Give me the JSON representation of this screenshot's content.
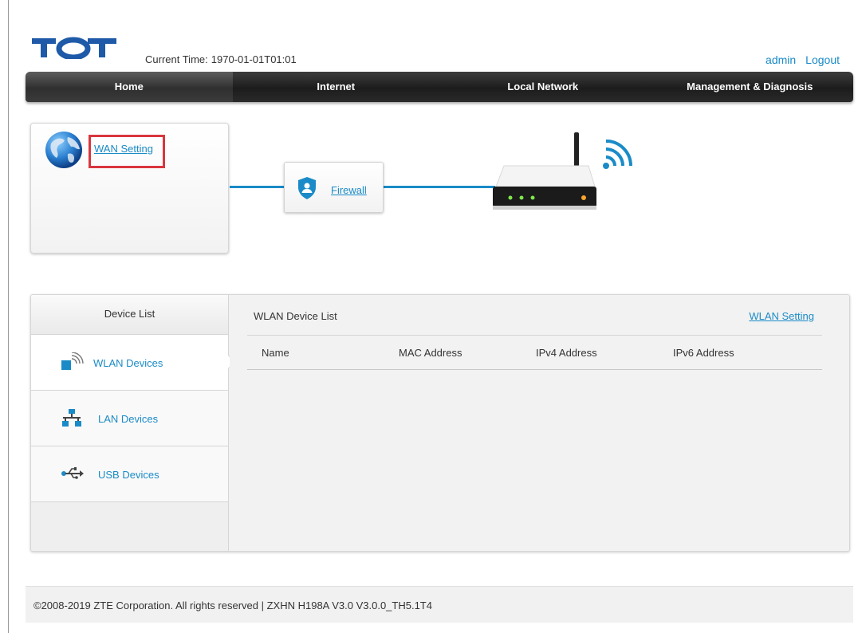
{
  "header": {
    "logo_text": "TOT",
    "current_time_label": "Current Time:",
    "current_time_value": "1970-01-01T01:01",
    "user": "admin",
    "logout": "Logout"
  },
  "nav": {
    "items": [
      {
        "label": "Home",
        "active": true
      },
      {
        "label": "Internet",
        "active": false
      },
      {
        "label": "Local Network",
        "active": false
      },
      {
        "label": "Management & Diagnosis",
        "active": false
      }
    ]
  },
  "topology": {
    "wan_link": "WAN Setting",
    "firewall_link": "Firewall"
  },
  "device_panel": {
    "side_title": "Device List",
    "side_items": [
      {
        "label": "WLAN Devices",
        "icon": "wifi-device-icon",
        "active": true
      },
      {
        "label": "LAN Devices",
        "icon": "network-icon",
        "active": false
      },
      {
        "label": "USB Devices",
        "icon": "usb-icon",
        "active": false
      }
    ],
    "list_title": "WLAN Device List",
    "list_link": "WLAN Setting",
    "columns": [
      "Name",
      "MAC Address",
      "IPv4 Address",
      "IPv6 Address"
    ],
    "rows": []
  },
  "footer": {
    "text": "©2008-2019 ZTE Corporation. All rights reserved  |  ZXHN H198A V3.0 V3.0.0_TH5.1T4"
  },
  "colors": {
    "accent": "#1a8bc7",
    "highlight": "#d9363e",
    "navbar": "#222222"
  }
}
